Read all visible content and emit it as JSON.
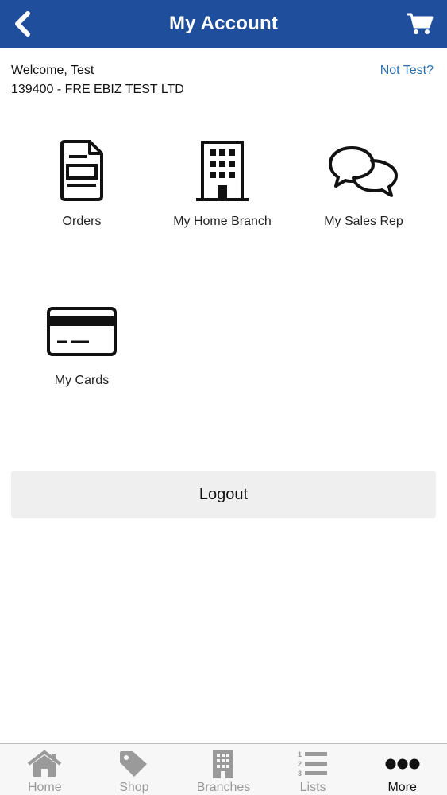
{
  "header": {
    "title": "My Account",
    "back_icon": "chevron-left-icon",
    "cart_icon": "cart-icon",
    "background": "#1f4e9c"
  },
  "account": {
    "welcome": "Welcome, Test",
    "account_line": "139400 - FRE EBIZ TEST LTD",
    "not_user_link": "Not Test?"
  },
  "tiles": [
    {
      "label": "Orders",
      "icon": "document-icon"
    },
    {
      "label": "My Home Branch",
      "icon": "building-icon"
    },
    {
      "label": "My Sales Rep",
      "icon": "chat-bubbles-icon"
    },
    {
      "label": "My Cards",
      "icon": "credit-card-icon"
    }
  ],
  "logout": {
    "label": "Logout"
  },
  "bottom_nav": {
    "items": [
      {
        "label": "Home",
        "icon": "home-icon",
        "active": false
      },
      {
        "label": "Shop",
        "icon": "tag-icon",
        "active": false
      },
      {
        "label": "Branches",
        "icon": "building-icon",
        "active": false
      },
      {
        "label": "Lists",
        "icon": "numbered-list-icon",
        "active": false
      },
      {
        "label": "More",
        "icon": "more-dots-icon",
        "active": true
      }
    ]
  }
}
